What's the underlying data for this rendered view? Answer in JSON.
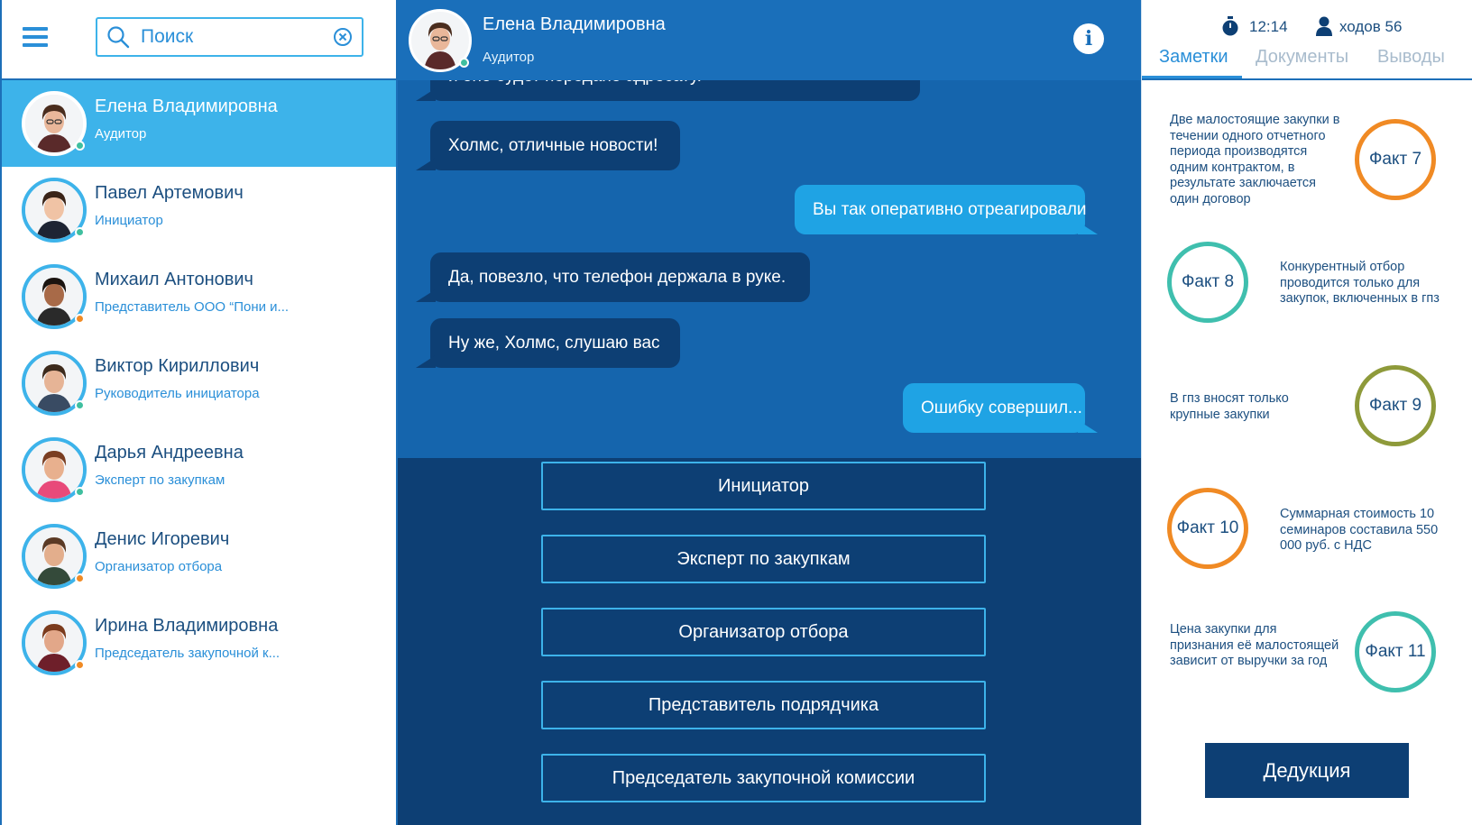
{
  "search": {
    "placeholder": "Поиск"
  },
  "contacts": [
    {
      "name": "Елена Владимировна",
      "role": "Аудитор",
      "status_color": "#3fbf9f",
      "active": true
    },
    {
      "name": "Павел Артемович",
      "role": "Инициатор",
      "status_color": "#3fbf9f"
    },
    {
      "name": "Михаил Антонович",
      "role": "Представитель ООО “Пони и...",
      "status_color": "#f08a24"
    },
    {
      "name": "Виктор Кириллович",
      "role": "Руководитель инициатора",
      "status_color": "#3fbf9f"
    },
    {
      "name": "Дарья Андреевна",
      "role": "Эксперт по закупкам",
      "status_color": "#3fbf9f"
    },
    {
      "name": "Денис Игоревич",
      "role": "Организатор отбора",
      "status_color": "#f08a24"
    },
    {
      "name": "Ирина Владимировна",
      "role": "Председатель закупочной к...",
      "status_color": "#f08a24"
    }
  ],
  "chat": {
    "header": {
      "name": "Елена Владимировна",
      "role": "Аудитор",
      "info_label": "i"
    },
    "messages": [
      {
        "side": "in",
        "text": "и оно будет передано адресату."
      },
      {
        "side": "in",
        "text": "Холмс, отличные новости!"
      },
      {
        "side": "out",
        "text": "Вы так оперативно отреагировали"
      },
      {
        "side": "in",
        "text": "Да, повезло, что телефон держала в руке."
      },
      {
        "side": "in",
        "text": "Ну же, Холмс, слушаю вас"
      },
      {
        "side": "out",
        "text": "Ошибку совершил..."
      }
    ],
    "answers": [
      "Инициатор",
      "Эксперт по закупкам",
      "Организатор отбора",
      "Представитель подрядчика",
      "Председатель закупочной комиссии"
    ]
  },
  "right": {
    "timer": "12:14",
    "moves": "ходов 56",
    "tabs": [
      "Заметки",
      "Документы",
      "Выводы"
    ],
    "facts": [
      {
        "label": "Факт 7",
        "color": "#f08a24",
        "text": "Две малостоящие закупки в течении одного отчетного периода производятся одним контрактом, в результате заключается один договор"
      },
      {
        "label": "Факт 8",
        "color": "#3fbfae",
        "text": "Конкурентный отбор проводится только для закупок, включенных в гпз"
      },
      {
        "label": "Факт 9",
        "color": "#8e9a3a",
        "text": "В гпз вносят только крупные закупки"
      },
      {
        "label": "Факт 10",
        "color": "#f08a24",
        "text": "Суммарная стоимость 10 семинаров составила 550 000 руб. с НДС"
      },
      {
        "label": "Факт 11",
        "color": "#3fbfae",
        "text": "Цена закупки для признания её малостоящей зависит от выручки за год"
      }
    ],
    "deduction_label": "Дедукция"
  }
}
